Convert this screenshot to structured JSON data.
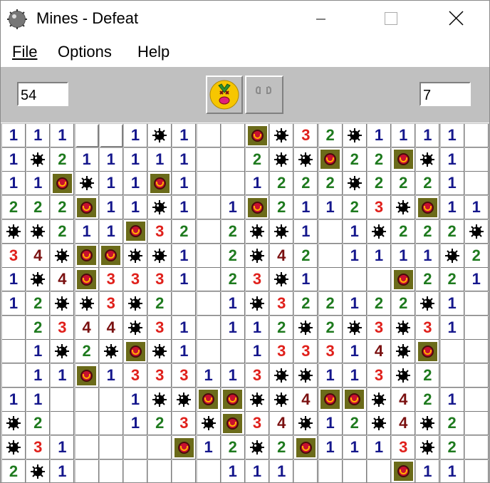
{
  "window": {
    "title": "Mines - Defeat"
  },
  "menu": [
    "File",
    "Options",
    "Help"
  ],
  "panel": {
    "mines_remaining": "54",
    "time": "7"
  },
  "icons": {
    "app": "mine-icon",
    "face": "dead-face-icon",
    "hint": "hint-icon",
    "mine": "mine-icon",
    "flag": "flagged-mine-icon"
  },
  "colors": {
    "one": "#15178c",
    "two": "#1e7a1e",
    "three": "#e0201b",
    "four": "#7a1010",
    "flag_bg": "#6b6b1a",
    "flag_ball": "#c8102e"
  },
  "board": {
    "legend": {
      "digit": "revealed count",
      "*": "mine",
      "F": "flagged mine",
      ".": "empty revealed",
      "#": "unrevealed"
    },
    "rows": [
      "1 1 1 # # 1 * 1 . . F * 3 2 * 1 1 1 1 .",
      "1 * 2 1 1 1 1 1 . . 2 * * F 2 2 F * 1 .",
      "1 1 F * 1 1 F 1 . . 1 2 2 2 * 2 2 2 1 .",
      "2 2 2 F 1 1 * 1 . 1 F 2 1 1 2 3 * F 1 1",
      "* * 2 1 1 F 3 2 . 2 * * 1 . 1 * 2 2 2 *",
      "3 4 * F F * * 1 . 2 * 4 2 . 1 1 1 1 * 2",
      "1 * 4 F 3 3 3 1 . 2 3 * 1 . . . F 2 2 1",
      "1 2 * * 3 * 2 . . 1 * 3 2 2 1 2 2 * 1 .",
      ". 2 3 4 4 * 3 1 . 1 1 2 * 2 * 3 * 3 1 .",
      ". 1 * 2 * F * 1 . . 1 3 3 3 1 4 * F . .",
      ". 1 1 F 1 3 3 3 1 1 3 * * 1 1 3 * 2 . .",
      "1 1 . . . 1 * * F F * * 4 F F * 4 2 1 .",
      "* 2 . . . 1 2 3 * F 3 4 * 1 2 * 4 * 2 .",
      "* 3 1 . . . . F 1 2 * 2 F 1 1 1 3 * 2 .",
      "2 * 1 . . . . . . 1 1 1 . . . . F 1 1 ."
    ]
  }
}
